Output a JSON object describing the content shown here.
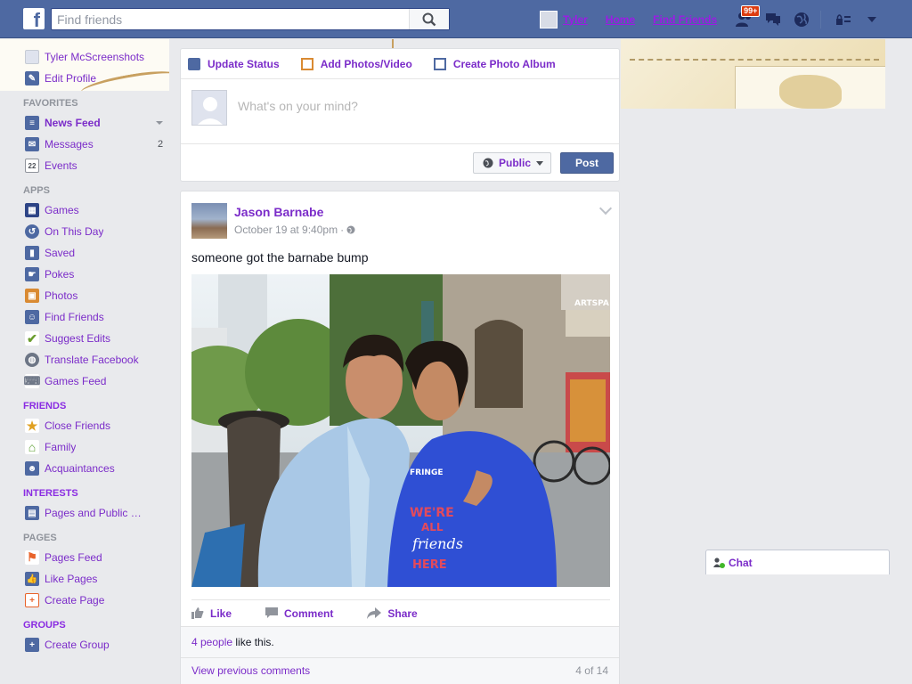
{
  "topbar": {
    "logo": "f",
    "search_placeholder": "Find friends",
    "user_name": "Tyler",
    "home_label": "Home",
    "find_friends_label": "Find Friends",
    "friend_requests_badge": "99+"
  },
  "sidebar": {
    "profile": {
      "name": "Tyler McScreenshots",
      "edit_label": "Edit Profile"
    },
    "sections": {
      "favorites": "FAVORITES",
      "apps": "APPS",
      "friends": "FRIENDS",
      "interests": "INTERESTS",
      "pages": "PAGES",
      "groups": "GROUPS"
    },
    "favorites": [
      {
        "label": "News Feed",
        "icon": "news-feed-icon"
      },
      {
        "label": "Messages",
        "count": "2",
        "icon": "messages-icon"
      },
      {
        "label": "Events",
        "icon": "events-icon",
        "icon_text": "22"
      }
    ],
    "apps": [
      {
        "label": "Games",
        "icon": "games-icon"
      },
      {
        "label": "On This Day",
        "icon": "on-this-day-icon"
      },
      {
        "label": "Saved",
        "icon": "saved-icon"
      },
      {
        "label": "Pokes",
        "icon": "pokes-icon"
      },
      {
        "label": "Photos",
        "icon": "photos-icon"
      },
      {
        "label": "Find Friends",
        "icon": "find-friends-icon"
      },
      {
        "label": "Suggest Edits",
        "icon": "suggest-edits-icon"
      },
      {
        "label": "Translate Facebook",
        "icon": "translate-icon"
      },
      {
        "label": "Games Feed",
        "icon": "games-feed-icon"
      }
    ],
    "friends": [
      {
        "label": "Close Friends",
        "icon": "close-friends-icon"
      },
      {
        "label": "Family",
        "icon": "family-icon"
      },
      {
        "label": "Acquaintances",
        "icon": "acquaintances-icon"
      }
    ],
    "interests": [
      {
        "label": "Pages and Public …",
        "icon": "pages-public-icon"
      }
    ],
    "pages": [
      {
        "label": "Pages Feed",
        "icon": "pages-feed-icon"
      },
      {
        "label": "Like Pages",
        "icon": "like-pages-icon"
      },
      {
        "label": "Create Page",
        "icon": "create-page-icon"
      }
    ],
    "groups": [
      {
        "label": "Create Group",
        "icon": "create-group-icon"
      }
    ]
  },
  "composer": {
    "tabs": [
      "Update Status",
      "Add Photos/Video",
      "Create Photo Album"
    ],
    "placeholder": "What's on your mind?",
    "privacy_label": "Public",
    "post_label": "Post"
  },
  "story": {
    "author": "Jason Barnabe",
    "timestamp": "October 19 at 9:40pm",
    "separator": "·",
    "text": "someone got the barnabe bump",
    "photo_text": {
      "store_sign": "ARTSPA",
      "shirt_line1": "WE'RE",
      "shirt_line2": "ALL",
      "shirt_line3": "friends",
      "shirt_line4": "HERE",
      "shirt_top": "FRINGE"
    },
    "actions": [
      "Like",
      "Comment",
      "Share"
    ],
    "likes": {
      "link": "4 people",
      "suffix": " like this."
    },
    "prev_comments": "View previous comments",
    "comment_count": "4 of 14"
  },
  "chat": {
    "label": "Chat"
  },
  "colors": {
    "brand_blue": "#4e69a2",
    "link_purple": "#7b2cc9",
    "page_bg": "#e9eaed"
  }
}
